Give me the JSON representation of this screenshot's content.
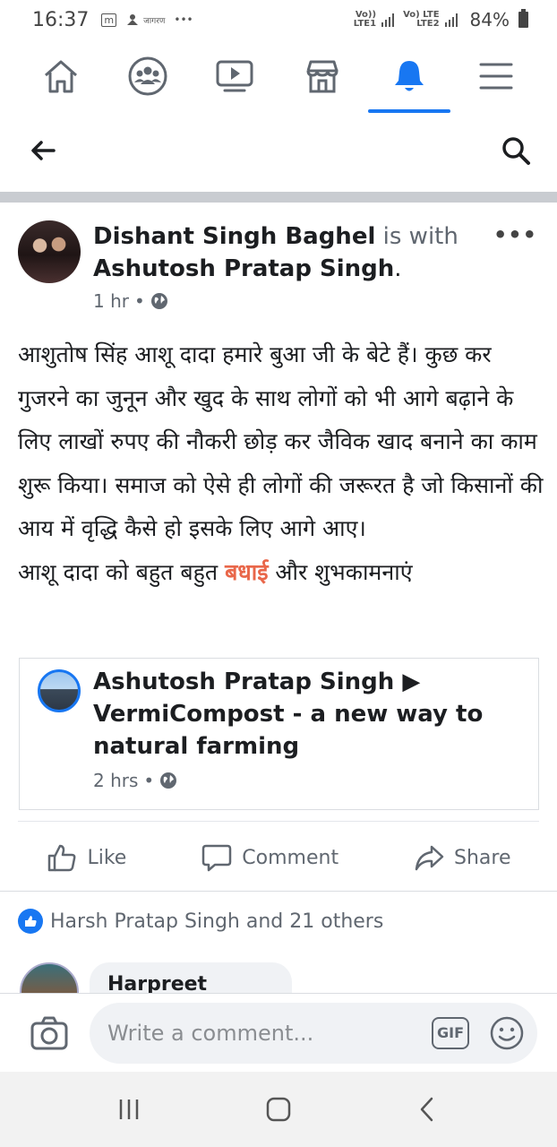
{
  "status_bar": {
    "time": "16:37",
    "notif_1": "m",
    "notif_2": "जागरण",
    "notif_more": "•••",
    "net_1_top": "Vo))",
    "net_1_bottom": "LTE1",
    "net_2_top": "Vo) LTE",
    "net_2_bottom": "LTE2",
    "battery": "84%"
  },
  "nav": {
    "tabs": [
      {
        "icon": "home-icon",
        "active": false
      },
      {
        "icon": "groups-icon",
        "active": false
      },
      {
        "icon": "watch-icon",
        "active": false
      },
      {
        "icon": "marketplace-icon",
        "active": false
      },
      {
        "icon": "notifications-icon",
        "active": true
      },
      {
        "icon": "menu-icon",
        "active": false
      }
    ],
    "accent_color": "#1877f2"
  },
  "post": {
    "author": "Dishant Singh Baghel",
    "with_text": "is with",
    "tagged": "Ashutosh Pratap Singh",
    "tagged_suffix": ".",
    "time": "1 hr",
    "dot": "•",
    "text_main": "आशुतोष सिंह आशू दादा हमारे बुआ जी के बेटे हैं। कुछ कर गुजरने का जुनून और खुद के साथ लोगों को भी आगे बढ़ाने के लिए लाखों रुपए की नौकरी छोड़ कर जैविक खाद बनाने का काम शुरू किया। समाज को ऐसे ही लोगों की जरूरत है जो किसानों की आय में वृद्धि कैसे हो इसके लिए आगे आए।",
    "text_line2_pre": "आशू दादा को बहुत बहुत ",
    "text_highlight": "बधाई",
    "text_line2_post": " और शुभकामनाएं",
    "highlight_color": "#e9674a"
  },
  "shared": {
    "title": "Ashutosh Pratap Singh ▶ VermiCompost - a new way to natural farming",
    "time": "2 hrs",
    "dot": "•"
  },
  "actions": {
    "like": "Like",
    "comment": "Comment",
    "share": "Share"
  },
  "reactions": {
    "text": "Harsh Pratap Singh and 21 others"
  },
  "comments": [
    {
      "author": "Harpreet Singh"
    }
  ],
  "composer": {
    "placeholder": "Write a comment...",
    "gif": "GIF"
  }
}
